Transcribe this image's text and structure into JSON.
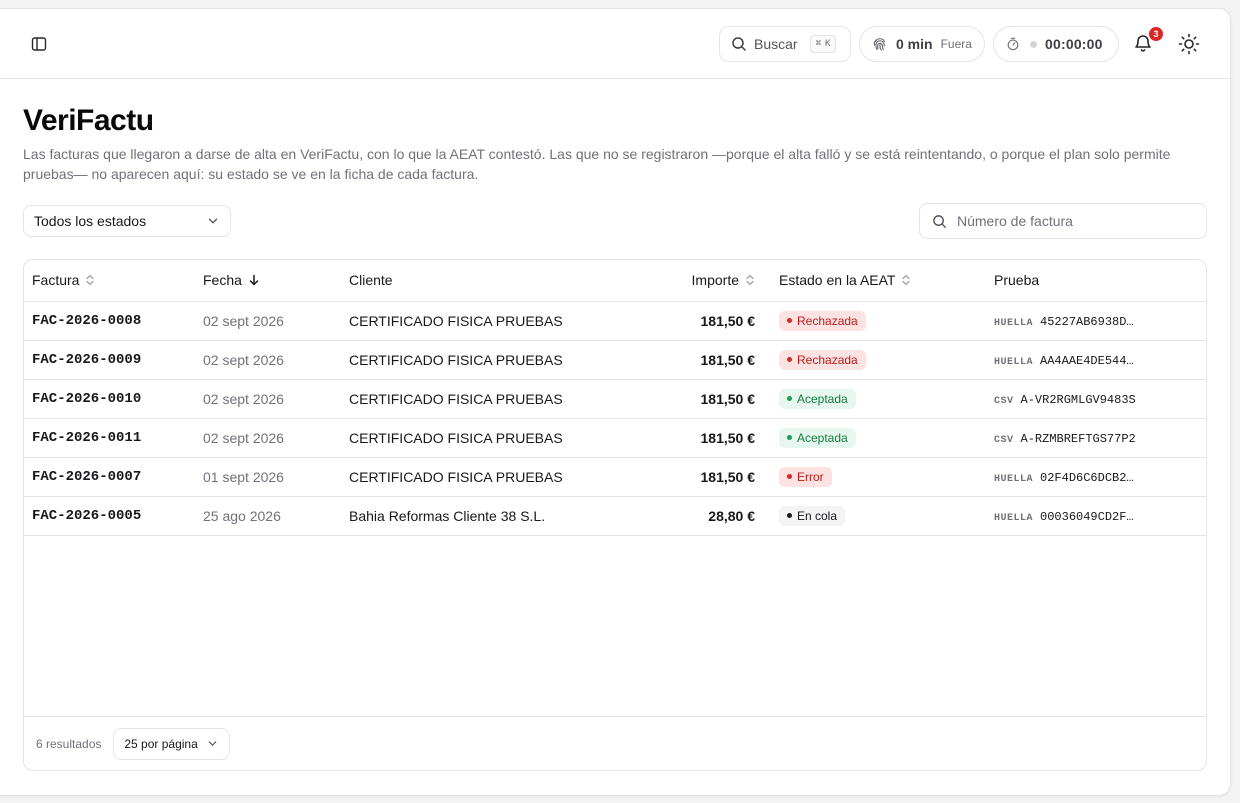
{
  "header": {
    "search_label": "Buscar",
    "search_shortcut": [
      "⌘",
      "K"
    ],
    "worktime_value": "0 min",
    "worktime_status": "Fuera",
    "timer_value": "00:00:00",
    "notifications_count": "3"
  },
  "page": {
    "title": "VeriFactu",
    "description": "Las facturas que llegaron a darse de alta en VeriFactu, con lo que la AEAT contestó. Las que no se registraron —porque el alta falló y se está reintentando, o porque el plan solo permite pruebas— no aparecen aquí: su estado se ve en la ficha de cada factura."
  },
  "filters": {
    "status_selected": "Todos los estados",
    "invoice_search_placeholder": "Número de factura"
  },
  "table": {
    "columns": {
      "invoice": "Factura",
      "date": "Fecha",
      "client": "Cliente",
      "amount": "Importe",
      "status": "Estado en la AEAT",
      "proof": "Prueba"
    },
    "rows": [
      {
        "invoice": "FAC-2026-0008",
        "date": "02 sept 2026",
        "client": "CERTIFICADO FISICA PRUEBAS",
        "amount": "181,50 €",
        "status": "Rechazada",
        "status_kind": "rej",
        "proof_kind": "HUELLA",
        "proof_value": "45227AB6938D…"
      },
      {
        "invoice": "FAC-2026-0009",
        "date": "02 sept 2026",
        "client": "CERTIFICADO FISICA PRUEBAS",
        "amount": "181,50 €",
        "status": "Rechazada",
        "status_kind": "rej",
        "proof_kind": "HUELLA",
        "proof_value": "AA4AAE4DE544…"
      },
      {
        "invoice": "FAC-2026-0010",
        "date": "02 sept 2026",
        "client": "CERTIFICADO FISICA PRUEBAS",
        "amount": "181,50 €",
        "status": "Aceptada",
        "status_kind": "ok",
        "proof_kind": "CSV",
        "proof_value": "A-VR2RGMLGV9483S"
      },
      {
        "invoice": "FAC-2026-0011",
        "date": "02 sept 2026",
        "client": "CERTIFICADO FISICA PRUEBAS",
        "amount": "181,50 €",
        "status": "Aceptada",
        "status_kind": "ok",
        "proof_kind": "CSV",
        "proof_value": "A-RZMBREFTGS77P2"
      },
      {
        "invoice": "FAC-2026-0007",
        "date": "01 sept 2026",
        "client": "CERTIFICADO FISICA PRUEBAS",
        "amount": "181,50 €",
        "status": "Error",
        "status_kind": "err",
        "proof_kind": "HUELLA",
        "proof_value": "02F4D6C6DCB2…"
      },
      {
        "invoice": "FAC-2026-0005",
        "date": "25 ago 2026",
        "client": "Bahia Reformas Cliente 38 S.L.",
        "amount": "28,80 €",
        "status": "En cola",
        "status_kind": "q",
        "proof_kind": "HUELLA",
        "proof_value": "00036049CD2F…"
      }
    ]
  },
  "footer": {
    "results": "6 resultados",
    "per_page": "25 por página"
  },
  "icons": {
    "sidebar": "sidebar-toggle-icon",
    "search": "search-icon",
    "worktime": "fingerprint-icon",
    "timer": "stopwatch-icon",
    "notifications": "bell-icon",
    "theme": "sun-icon"
  },
  "colors": {
    "danger": "#dc2626",
    "success": "#16a34a",
    "border": "#e4e4e7",
    "muted_text": "#71717a"
  }
}
